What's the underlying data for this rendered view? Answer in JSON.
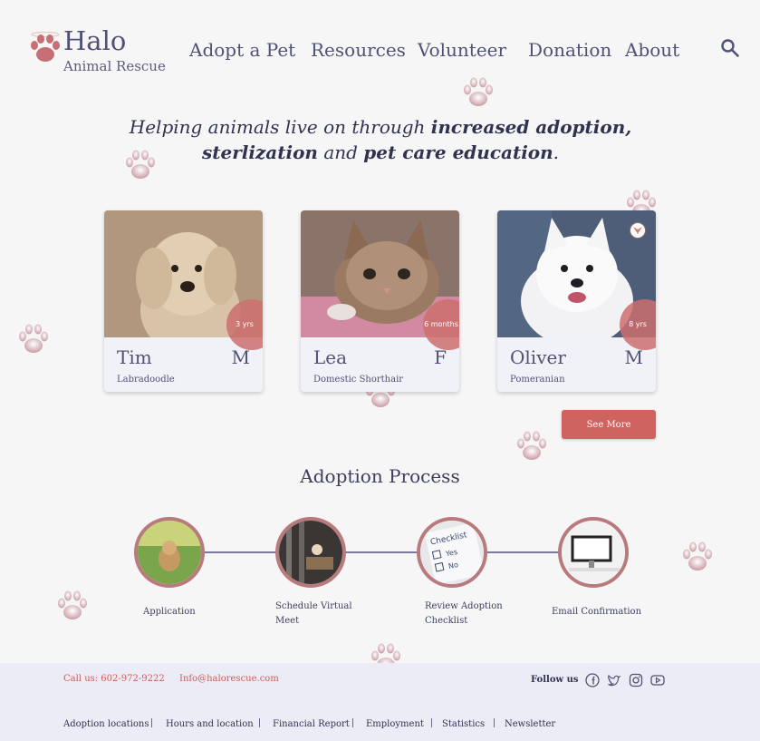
{
  "header": {
    "logo_title": "Halo",
    "logo_subtitle": "Animal Rescue",
    "nav": [
      "Adopt a Pet",
      "Resources",
      "Volunteer",
      "Donation",
      "About"
    ],
    "search_icon": "search-icon"
  },
  "tagline": {
    "p1": "Helping animals live on through ",
    "b1": "increased adoption,",
    "b2": "sterlization",
    "p2": " and ",
    "b3": "pet care education",
    "p3": "."
  },
  "pets": [
    {
      "name": "Tim",
      "sex": "M",
      "breed": "Labradoodle",
      "age": "3 yrs"
    },
    {
      "name": "Lea",
      "sex": "F",
      "breed": "Domestic Shorthair",
      "age": "6 months"
    },
    {
      "name": "Oliver",
      "sex": "M",
      "breed": "Pomeranian",
      "age": "8 yrs"
    }
  ],
  "see_more": "See More",
  "process": {
    "title": "Adoption Process",
    "steps": [
      "Application",
      "Schedule Virtual Meet",
      "Review Adoption Checklist",
      "Email Confirmation"
    ],
    "checklist_text": [
      "Checklist",
      "Yes",
      "No"
    ]
  },
  "footer": {
    "call": "Call us: 602-972-9222",
    "email": "Info@halorescue.com",
    "follow": "Follow us",
    "social": [
      "facebook-icon",
      "twitter-icon",
      "instagram-icon",
      "youtube-icon"
    ],
    "links": [
      "Adoption locations",
      "Hours and location",
      "Financial Report",
      "Employment",
      "Statistics",
      "Newsletter"
    ]
  },
  "colors": {
    "accent": "#cf6360",
    "text": "#4f5274",
    "footer_bg": "#ececf6"
  }
}
